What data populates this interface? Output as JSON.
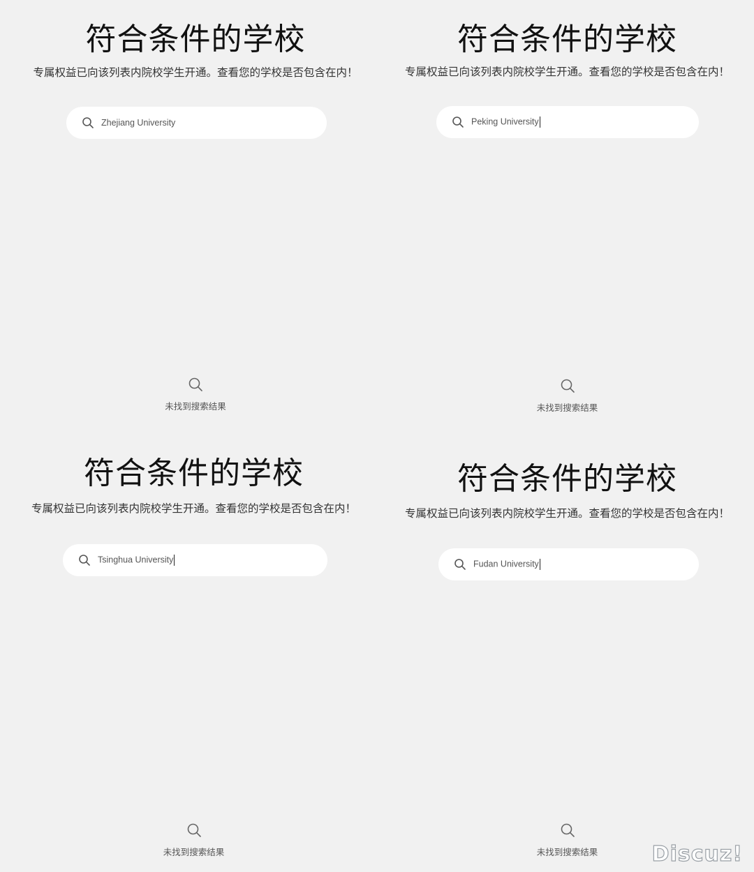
{
  "panels": [
    {
      "title": "符合条件的学校",
      "subtitle": "专属权益已向该列表内院校学生开通。查看您的学校是否包含在内！",
      "search_value": "Zhejiang University",
      "empty_text": "未找到搜索结果",
      "icon": "search-icon"
    },
    {
      "title": "符合条件的学校",
      "subtitle": "专属权益已向该列表内院校学生开通。查看您的学校是否包含在内！",
      "search_value": "Peking University",
      "empty_text": "未找到搜索结果",
      "icon": "search-icon"
    },
    {
      "title": "符合条件的学校",
      "subtitle": "专属权益已向该列表内院校学生开通。查看您的学校是否包含在内！",
      "search_value": "Tsinghua University",
      "empty_text": "未找到搜索结果",
      "icon": "search-icon"
    },
    {
      "title": "符合条件的学校",
      "subtitle": "专属权益已向该列表内院校学生开通。查看您的学校是否包含在内！",
      "search_value": "Fudan University",
      "empty_text": "未找到搜索结果",
      "icon": "search-icon"
    }
  ],
  "watermark": "Discuz!",
  "colors": {
    "background": "#f1f1f1",
    "search_box": "#ffffff",
    "title": "#111111",
    "muted_text": "#555555"
  }
}
